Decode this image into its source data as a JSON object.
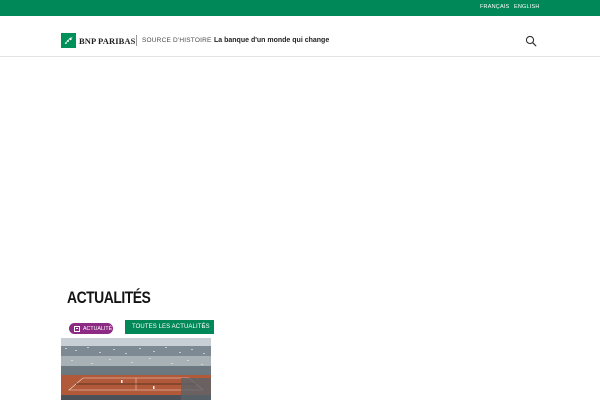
{
  "topbar": {
    "lang_fr": "FRANÇAIS",
    "lang_en": "ENGLISH"
  },
  "header": {
    "brand": "BNP PARIBAS",
    "source": "SOURCE D'HISTOIRE",
    "tagline": "La banque d'un monde qui change",
    "search_icon": "search-icon"
  },
  "news": {
    "title": "ACTUALITÉS",
    "badge": "ACTUALITÉ",
    "badge_icon": "newspaper-icon",
    "all_button": "TOUTES LES ACTUALITÉS",
    "all_button_icon": "arrow-right-icon"
  },
  "colors": {
    "brand_green": "#008859",
    "badge_purple": "#8c2a84"
  }
}
